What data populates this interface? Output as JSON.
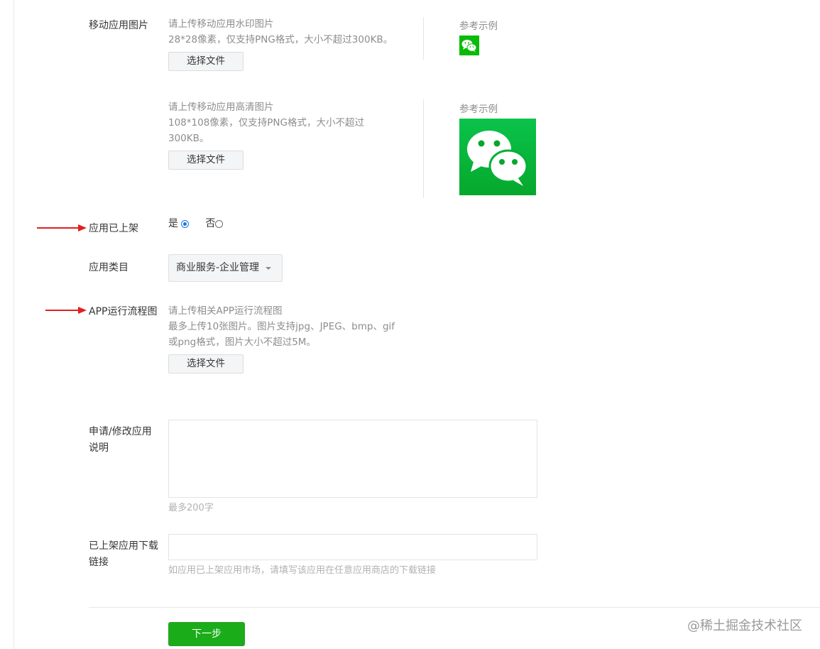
{
  "watermark_section": {
    "label": "移动应用图片",
    "tip_line1": "请上传移动应用水印图片",
    "tip_line2": "28*28像素，仅支持PNG格式，大小不超过300KB。",
    "button": "选择文件",
    "example_label": "参考示例"
  },
  "hd_section": {
    "tip_line1": "请上传移动应用高清图片",
    "tip_line2": "108*108像素，仅支持PNG格式，大小不超过",
    "tip_line3": "300KB。",
    "button": "选择文件",
    "example_label": "参考示例"
  },
  "listed": {
    "label": "应用已上架",
    "option_yes": "是",
    "option_no": "否",
    "selected": "是"
  },
  "category": {
    "label": "应用类目",
    "value": "商业服务-企业管理"
  },
  "flowchart": {
    "label": "APP运行流程图",
    "tip_line1": "请上传相关APP运行流程图",
    "tip_line2": "最多上传10张图片。图片支持jpg、JPEG、bmp、gif",
    "tip_line3": "或png格式，图片大小不超过5M。",
    "button": "选择文件"
  },
  "description": {
    "label_line1": "申请/修改应用",
    "label_line2": "说明",
    "value": "",
    "hint": "最多200字"
  },
  "download_link": {
    "label_line1": "已上架应用下载",
    "label_line2": "链接",
    "value": "",
    "hint": "如应用已上架应用市场，请填写该应用在任意应用商店的下载链接"
  },
  "next_button": "下一步",
  "watermark": "@稀土掘金技术社区",
  "colors": {
    "wechat_green": "#09bb07",
    "button_green": "#1aad19",
    "annotation_red": "#e02020",
    "radio_blue": "#1a73e8"
  }
}
